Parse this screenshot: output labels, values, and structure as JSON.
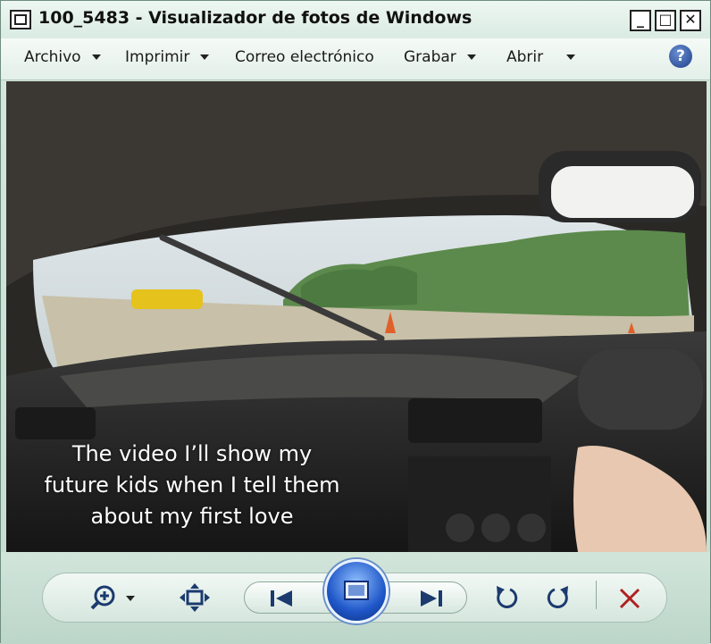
{
  "window": {
    "title": "100_5483 - Visualizador de fotos de Windows",
    "controls": {
      "minimize": "_",
      "maximize": "□",
      "close": "✕"
    }
  },
  "menu": {
    "items": [
      "Archivo",
      "Imprimir",
      "Correo electrónico",
      "Grabar",
      "Abrir"
    ],
    "help": "?"
  },
  "photo": {
    "caption_lines": [
      "The video I’ll show my",
      "future kids when I tell them",
      "about my first love"
    ]
  },
  "toolbar": {
    "icons": [
      "zoom-icon",
      "fit-window-icon",
      "previous-icon",
      "slideshow-icon",
      "next-icon",
      "rotate-left-icon",
      "rotate-right-icon",
      "delete-icon"
    ],
    "accent": "#1f56c8",
    "delete_color": "#b02020"
  }
}
